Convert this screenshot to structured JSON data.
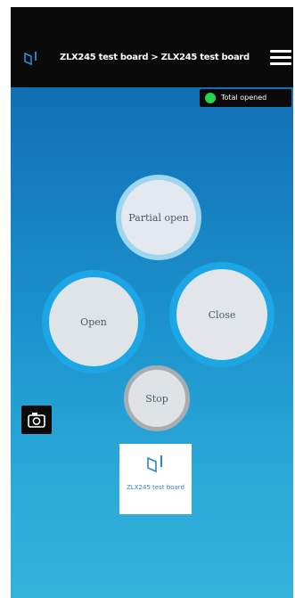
{
  "status_bar": {
    "left": "",
    "time": "",
    "right": ""
  },
  "header": {
    "title": "ZLX245 test board > ZLX245 test board",
    "logo_icon": "brand-logo-icon",
    "menu_icon": "hamburger-menu-icon"
  },
  "status": {
    "label": "Total opened",
    "color": "#26d34a"
  },
  "controls": {
    "partial_open": "Partial open",
    "open": "Open",
    "close": "Close",
    "stop": "Stop"
  },
  "camera": {
    "icon": "camera-icon"
  },
  "device_card": {
    "label": "ZLX245 test board",
    "icon": "brand-logo-icon"
  },
  "colors": {
    "accent": "#1da6e6",
    "button_fill": "#e3e9ee",
    "header_bg": "#0a0a0a"
  }
}
